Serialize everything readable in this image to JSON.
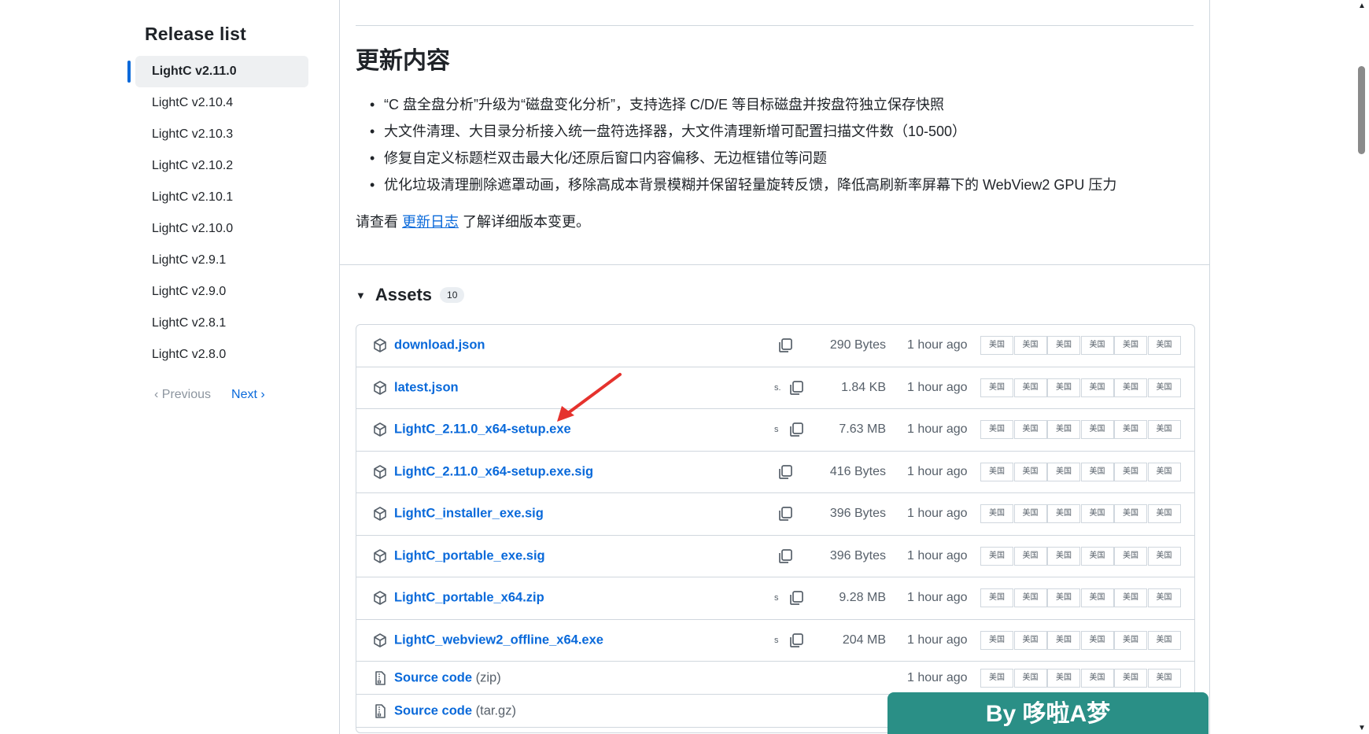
{
  "sidebar": {
    "title": "Release list",
    "items": [
      {
        "label": "LightC v2.11.0"
      },
      {
        "label": "LightC v2.10.4"
      },
      {
        "label": "LightC v2.10.3"
      },
      {
        "label": "LightC v2.10.2"
      },
      {
        "label": "LightC v2.10.1"
      },
      {
        "label": "LightC v2.10.0"
      },
      {
        "label": "LightC v2.9.1"
      },
      {
        "label": "LightC v2.9.0"
      },
      {
        "label": "LightC v2.8.1"
      },
      {
        "label": "LightC v2.8.0"
      }
    ],
    "prev_label": "‹  Previous",
    "next_label": "Next  ›"
  },
  "notes": {
    "title": "更新内容",
    "bullets": [
      "“C 盘全盘分析”升级为“磁盘变化分析”，支持选择 C/D/E 等目标磁盘并按盘符独立保存快照",
      "大文件清理、大目录分析接入统一盘符选择器，大文件清理新增可配置扫描文件数（10-500）",
      "修复自定义标题栏双击最大化/还原后窗口内容偏移、无边框错位等问题",
      "优化垃圾清理删除遮罩动画，移除高成本背景模糊并保留轻量旋转反馈，降低高刷新率屏幕下的 WebView2 GPU 压力"
    ],
    "changelog_prefix": "请查看 ",
    "changelog_link": "更新日志",
    "changelog_suffix": " 了解详细版本变更。"
  },
  "assets": {
    "title": "Assets",
    "count": "10",
    "flag_label": "美国",
    "rows": [
      {
        "name": "download.json",
        "suffix": "",
        "sflag": "",
        "size": "290 Bytes",
        "time": "1 hour ago"
      },
      {
        "name": "latest.json",
        "suffix": "",
        "sflag": "s.",
        "size": "1.84 KB",
        "time": "1 hour ago"
      },
      {
        "name": "LightC_2.11.0_x64-setup.exe",
        "suffix": "",
        "sflag": "s",
        "size": "7.63 MB",
        "time": "1 hour ago"
      },
      {
        "name": "LightC_2.11.0_x64-setup.exe.sig",
        "suffix": "",
        "sflag": "",
        "size": "416 Bytes",
        "time": "1 hour ago"
      },
      {
        "name": "LightC_installer_exe.sig",
        "suffix": "",
        "sflag": "",
        "size": "396 Bytes",
        "time": "1 hour ago"
      },
      {
        "name": "LightC_portable_exe.sig",
        "suffix": "",
        "sflag": "",
        "size": "396 Bytes",
        "time": "1 hour ago"
      },
      {
        "name": "LightC_portable_x64.zip",
        "suffix": "",
        "sflag": "s",
        "size": "9.28 MB",
        "time": "1 hour ago"
      },
      {
        "name": "LightC_webview2_offline_x64.exe",
        "suffix": "",
        "sflag": "s",
        "size": "204 MB",
        "time": "1 hour ago"
      },
      {
        "name": "Source code",
        "suffix": " (zip)",
        "sflag": "",
        "size": "",
        "time": "1 hour ago"
      },
      {
        "name": "Source code",
        "suffix": " (tar.gz)",
        "sflag": "",
        "size": "",
        "time": ""
      }
    ]
  },
  "watermark": "By 哆啦A梦",
  "colors": {
    "link": "#0969da",
    "accent": "#0969da",
    "watermark_bg": "#2a8f86",
    "arrow": "#e5322d"
  }
}
